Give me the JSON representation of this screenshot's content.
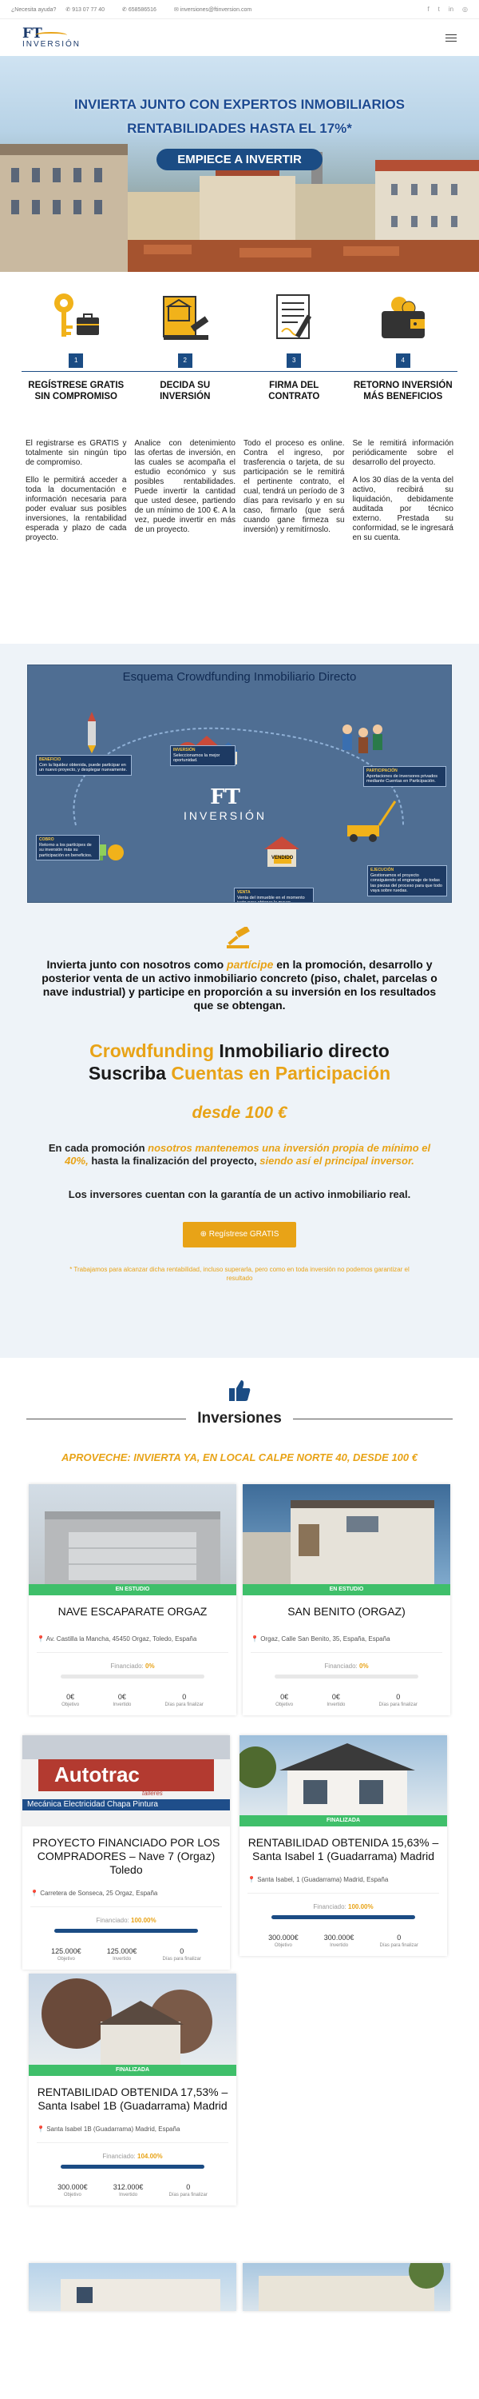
{
  "topbar": {
    "help": "¿Necesita ayuda?",
    "phone1": "913 07 77 40",
    "phone2": "658586516",
    "email": "inversiones@ftinversion.com"
  },
  "logo": {
    "ft": "FT",
    "inv": "INVERSIÓN"
  },
  "hero": {
    "line1": "INVIERTA JUNTO CON EXPERTOS INMOBILIARIOS",
    "line2": "RENTABILIDADES HASTA EL 17%*",
    "cta": "EMPIECE A INVERTIR"
  },
  "steps": [
    {
      "num": "1",
      "title": "REGÍSTRESE GRATIS SIN COMPROMISO",
      "p1": "El registrarse es GRATIS y totalmente sin ningún tipo de compromiso.",
      "p2": "Ello le permitirá acceder a toda la documentación e información necesaria para poder evaluar sus posibles inversiones, la rentabilidad esperada y plazo de cada proyecto."
    },
    {
      "num": "2",
      "title": "DECIDA SU INVERSIÓN",
      "p1": "Analice con detenimiento las ofertas de inversión, en las cuales se acompaña el estudio económico y sus posibles rentabilidades. Puede invertir la cantidad que usted desee, partiendo de un mínimo de 100 €. A la vez, puede invertir en más de un proyecto.",
      "p2": ""
    },
    {
      "num": "3",
      "title": "FIRMA DEL CONTRATO",
      "p1": "Todo el proceso es online. Contra el ingreso, por trasferencia o tarjeta, de su participación se le remitirá el pertinente contrato, el cual, tendrá un período de 3 días para revisarlo y en su caso, firmarlo (que será cuando gane firmeza su inversión) y remitírnoslo.",
      "p2": ""
    },
    {
      "num": "4",
      "title": "RETORNO INVERSIÓN MÁS BENEFICIOS",
      "p1": "Se le remitirá información periódicamente sobre el desarrollo del proyecto.",
      "p2": "A los 30 días de la venta del activo, recibirá su liquidación, debidamente auditada por técnico externo. Prestada su conformidad, se le ingresará en su cuenta."
    }
  ],
  "infographic": {
    "title": "Esquema Crowdfunding Inmobiliario Directo",
    "b1t": "INVERSIÓN",
    "b1": "Seleccionamos la mejor oportunidad.",
    "b2t": "BENEFICIO",
    "b2": "Con la liquidez obtenida, puede participar en un nuevo proyecto, y desplegar nuevamente.",
    "b3t": "PARTICIPACIÓN",
    "b3": "Aportaciones de inversores privados mediante Cuentas en Participación.",
    "b4t": "COBRO",
    "b4": "Retorno a los partícipes de su inversión más su participación en beneficios.",
    "b5t": "EJECUCIÓN",
    "b5": "Gestionamos el proyecto consiguiendo el engranaje de todas las piezas del proceso para que todo vaya sobre ruedas.",
    "b6t": "VENTA",
    "b6": "Venta del inmueble en el momento justo para obtener la mayor rentabilidad.",
    "b7": "VENDIDO",
    "ft": "FT",
    "inv": "INVERSIÓN"
  },
  "crowd": {
    "intro_a": "Invierta junto con nosotros como ",
    "intro_b": "partícipe",
    "intro_c": " en la promoción, desarrollo y posterior venta de un activo inmobiliario concreto (piso, chalet, parcelas o nave industrial) y participe en proporción a su inversión en los resultados que se obtengan.",
    "big1a": "Crowdfunding",
    "big1b": " Inmobiliario directo",
    "big2a": "Suscriba ",
    "big2b": "Cuentas en Participación",
    "from": "desde 100 €",
    "promo_a": "En cada promoción ",
    "promo_b": "nosotros mantenemos una inversión propia de mínimo el 40%,",
    "promo_c": " hasta la finalización del proyecto, ",
    "promo_d": "siendo así el principal inversor.",
    "guar": "Los inversores cuentan con la garantía de un activo inmobiliario real.",
    "reg": "Regístrese GRATIS",
    "note": "* Trabajamos para alcanzar dicha rentabilidad, incluso superarla, pero como en toda inversión no podemos garantizar el resultado"
  },
  "inv": {
    "title": "Inversiones",
    "aprov": "APROVECHE: INVIERTA YA, EN LOCAL CALPE NORTE 40, DESDE 100 €"
  },
  "labels": {
    "fin": "Financiado: ",
    "obj": "Objetivo",
    "invd": "Invertido",
    "dias": "Días para finalizar"
  },
  "cards": [
    {
      "badge": "EN ESTUDIO",
      "title": "NAVE ESCAPARATE ORGAZ",
      "addr": "Av. Castilla la Mancha, 45450 Orgaz, Toledo, España",
      "fin": "0%",
      "progress": 0,
      "obj": "0€",
      "invd": "0€",
      "dias": "0"
    },
    {
      "badge": "EN ESTUDIO",
      "title": "SAN BENITO (ORGAZ)",
      "addr": "Orgaz, Calle San Benito, 35, España, España",
      "fin": "0%",
      "progress": 0,
      "obj": "0€",
      "invd": "0€",
      "dias": "0"
    },
    {
      "badge": "",
      "title": "PROYECTO FINANCIADO POR LOS COMPRADORES – Nave 7 (Orgaz) Toledo",
      "addr": "Carretera de Sonseca, 25 Orgaz, España",
      "fin": "100.00%",
      "progress": 100,
      "obj": "125.000€",
      "invd": "125.000€",
      "dias": "0",
      "sign1": "Autotrac",
      "sign2": "talleres",
      "sign3": "Mecánica Electricidad Chapa Pintura"
    },
    {
      "badge": "FINALIZADA",
      "title": "RENTABILIDAD OBTENIDA 15,63% – Santa Isabel 1 (Guadarrama) Madrid",
      "addr": "Santa Isabel, 1 (Guadarrama) Madrid, España",
      "fin": "100.00%",
      "progress": 100,
      "obj": "300.000€",
      "invd": "300.000€",
      "dias": "0"
    },
    {
      "badge": "FINALIZADA",
      "title": "RENTABILIDAD OBTENIDA 17,53% – Santa Isabel 1B (Guadarrama) Madrid",
      "addr": "Santa Isabel 1B (Guadarrama) Madrid, España",
      "fin": "104.00%",
      "progress": 100,
      "obj": "300.000€",
      "invd": "312.000€",
      "dias": "0"
    }
  ],
  "colors": {
    "accent": "#e8a317",
    "navy": "#1b4c84",
    "green": "#3fbf6a"
  }
}
